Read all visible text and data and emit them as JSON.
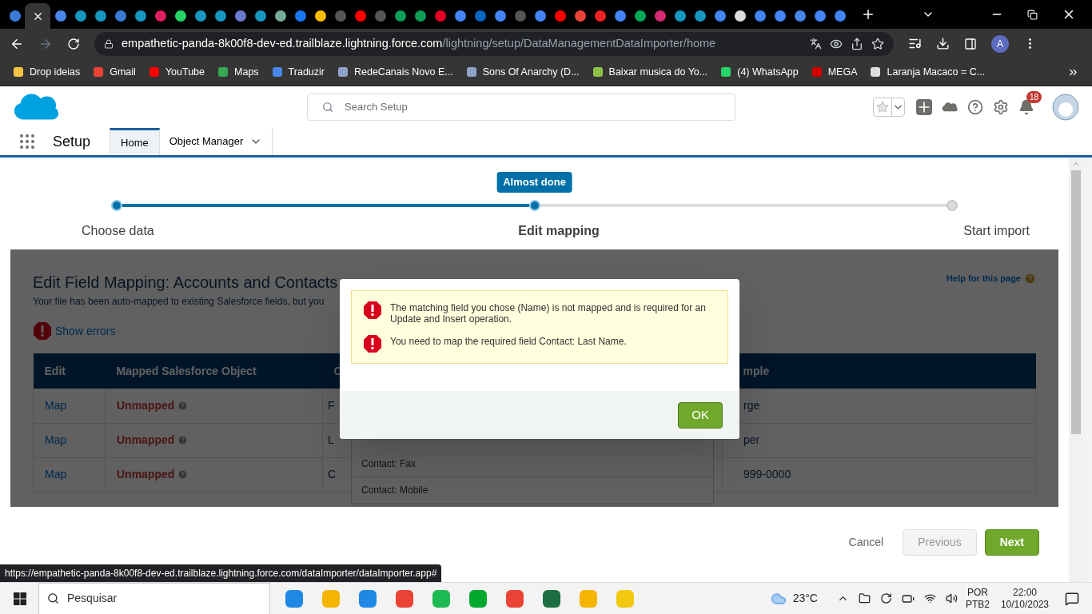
{
  "browser": {
    "tabs": [
      {
        "selected": false
      },
      {
        "selected": true
      },
      {
        "selected": false
      },
      {
        "selected": false
      },
      {
        "selected": false
      },
      {
        "selected": false
      },
      {
        "selected": false
      },
      {
        "selected": false
      },
      {
        "selected": false
      },
      {
        "selected": false
      },
      {
        "selected": false
      },
      {
        "selected": false
      },
      {
        "selected": false
      },
      {
        "selected": false
      },
      {
        "selected": false
      },
      {
        "selected": false
      },
      {
        "selected": false
      },
      {
        "selected": false
      },
      {
        "selected": false
      },
      {
        "selected": false
      },
      {
        "selected": false
      },
      {
        "selected": false
      },
      {
        "selected": false
      },
      {
        "selected": false
      },
      {
        "selected": false
      },
      {
        "selected": false
      },
      {
        "selected": false
      },
      {
        "selected": false
      },
      {
        "selected": false
      },
      {
        "selected": false
      },
      {
        "selected": false
      },
      {
        "selected": false
      },
      {
        "selected": false
      },
      {
        "selected": false
      },
      {
        "selected": false
      },
      {
        "selected": false
      },
      {
        "selected": false
      },
      {
        "selected": false
      },
      {
        "selected": false
      },
      {
        "selected": false
      },
      {
        "selected": false
      },
      {
        "selected": false
      }
    ],
    "url_host": "empathetic-panda-8k00f8-dev-ed.trailblaze.lightning.force.com",
    "url_path": "/lightning/setup/DataManagementDataImporter/home",
    "profile_initial": "A",
    "bookmarks": [
      "Drop ideias",
      "Gmail",
      "YouTube",
      "Maps",
      "Traduzir",
      "RedeCanais Novo E...",
      "Sons Of Anarchy (D...",
      "Baixar musica do Yo...",
      "(4) WhatsApp",
      "MEGA",
      "Laranja Macaco = C..."
    ],
    "status_url": "https://empathetic-panda-8k00f8-dev-ed.trailblaze.lightning.force.com/dataImporter/dataImporter.app#"
  },
  "header": {
    "search_placeholder": "Search Setup",
    "notifications": "18"
  },
  "nav": {
    "app": "Setup",
    "tabs": [
      {
        "label": "Home",
        "selected": true
      },
      {
        "label": "Object Manager",
        "selected": false
      }
    ]
  },
  "stepper": {
    "tooltip": "Almost done",
    "steps": [
      {
        "label": "Choose data",
        "reached": true,
        "selected": false
      },
      {
        "label": "Edit mapping",
        "reached": true,
        "selected": true
      },
      {
        "label": "Start import",
        "reached": false,
        "selected": false
      }
    ]
  },
  "mapping": {
    "title": "Edit Field Mapping: Accounts and Contacts",
    "subtitle": "Your file has been auto-mapped to existing Salesforce fields, but you",
    "show_errors": "Show errors",
    "help": "Help for this page",
    "columns": [
      "Edit",
      "Mapped Salesforce Object",
      "C",
      "mple"
    ],
    "rows": [
      {
        "edit": "Map",
        "mapped": "Unmapped",
        "unmapped": true,
        "column_3": "F",
        "example": "rge"
      },
      {
        "edit": "Map",
        "mapped": "Unmapped",
        "unmapped": true,
        "column_3": "L",
        "example": "per"
      },
      {
        "edit": "Map",
        "mapped": "Unmapped",
        "unmapped": true,
        "column_3": "C",
        "example": "999-0000"
      }
    ],
    "dropdown_options": [
      "Contact: Fax",
      "Contact: Mobile"
    ]
  },
  "dialog": {
    "errors": [
      "The matching field you chose (Name) is not mapped and is required for an Update and Insert operation.",
      "You need to map the required field Contact: Last Name."
    ],
    "ok": "OK"
  },
  "footer": {
    "cancel": "Cancel",
    "previous": {
      "label": "Previous",
      "disabled": true
    },
    "next": "Next"
  },
  "taskbar": {
    "search_placeholder": "Pesquisar",
    "temperature": "23°C",
    "language": "POR",
    "layout": "PTB2",
    "time": "22:00",
    "date": "10/10/2023"
  }
}
